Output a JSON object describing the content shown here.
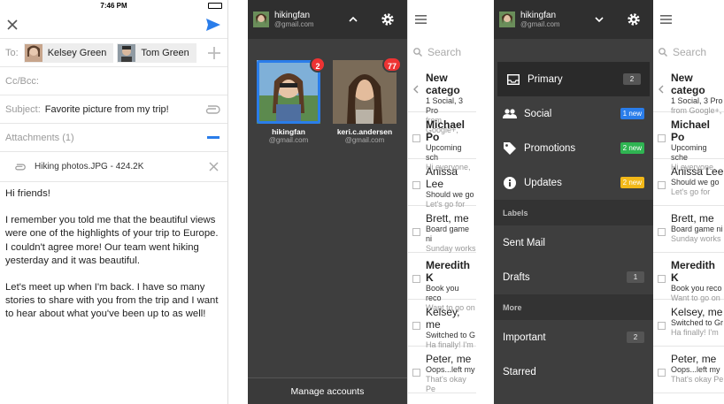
{
  "compose": {
    "time": "7:46 PM",
    "to_label": "To:",
    "recipients": [
      "Kelsey Green",
      "Tom Green"
    ],
    "ccbcc_label": "Cc/Bcc:",
    "subject_label": "Subject:",
    "subject_value": "Favorite picture from my trip!",
    "attachments_label": "Attachments (1)",
    "attachment_name": "Hiking photos.JPG - 424.2K",
    "body": [
      "Hi friends!",
      "I remember you told me that the beautiful views were one of the highlights of your trip to Europe. I couldn't agree more! Our team went hiking yesterday and it was beautiful.",
      "Let's meet up when I'm back. I have so many stories to share with you from the trip and I want to hear about what you've been up to as well!"
    ]
  },
  "switcher": {
    "user": "hikingfan",
    "user_email": "@gmail.com",
    "accounts": [
      {
        "name": "hikingfan",
        "email": "@gmail.com",
        "badge": "2"
      },
      {
        "name": "keri.c.andersen",
        "email": "@gmail.com",
        "badge": "77"
      }
    ],
    "manage_label": "Manage accounts"
  },
  "inbox1": {
    "search_placeholder": "Search",
    "mails": [
      {
        "from": "New catego",
        "subject": "1 Social, 3 Pro",
        "snippet": "from Google+,"
      },
      {
        "from": "Michael Po",
        "subject": "Upcoming sch",
        "snippet": "Hi everyone,"
      },
      {
        "from": "Anissa Lee",
        "subject": "Should we go",
        "snippet": "Let's go for"
      },
      {
        "from": "Brett, me",
        "subject": "Board game ni",
        "snippet": "Sunday works"
      },
      {
        "from": "Meredith K",
        "subject": "Book you reco",
        "snippet": "Want to go on"
      },
      {
        "from": "Kelsey, me",
        "subject": "Switched to G",
        "snippet": "Ha finally! I'm"
      },
      {
        "from": "Peter, me",
        "subject": "Oops...left my",
        "snippet": "That's okay Pe"
      }
    ]
  },
  "menu": {
    "user": "hikingfan",
    "user_email": "@gmail.com",
    "primary": {
      "label": "Primary",
      "count": "2"
    },
    "social": {
      "label": "Social",
      "badge": "1 new"
    },
    "promotions": {
      "label": "Promotions",
      "badge": "2 new"
    },
    "updates": {
      "label": "Updates",
      "badge": "2 new"
    },
    "labels_header": "Labels",
    "sent": "Sent Mail",
    "drafts": {
      "label": "Drafts",
      "count": "1"
    },
    "more_header": "More",
    "important": {
      "label": "Important",
      "count": "2"
    },
    "starred": "Starred"
  },
  "inbox2": {
    "search_placeholder": "Search",
    "mails": [
      {
        "from": "New catego",
        "subject": "1 Social, 3 Pro",
        "snippet": "from Google+,"
      },
      {
        "from": "Michael Po",
        "subject": "Upcoming sche",
        "snippet": "Hi everyone,"
      },
      {
        "from": "Anissa Lee",
        "subject": "Should we go",
        "snippet": "Let's go for"
      },
      {
        "from": "Brett, me",
        "subject": "Board game ni",
        "snippet": "Sunday works"
      },
      {
        "from": "Meredith K",
        "subject": "Book you reco",
        "snippet": "Want to go on"
      },
      {
        "from": "Kelsey, me",
        "subject": "Switched to Gr",
        "snippet": "Ha finally! I'm"
      },
      {
        "from": "Peter, me",
        "subject": "Oops...left my",
        "snippet": "That's okay Pe"
      }
    ]
  },
  "colors": {
    "accent": "#2a7dea",
    "drawer": "#3e3e3e",
    "badge_red": "#e33333",
    "social": "#2a7dea",
    "promotions": "#2fb452",
    "updates": "#f2b818"
  },
  "icons": [
    "close-icon",
    "send-icon",
    "add-icon",
    "paperclip-icon",
    "minus-icon",
    "gear-icon",
    "chevron-up-icon",
    "chevron-down-icon",
    "menu-icon",
    "search-icon",
    "inbox-icon",
    "people-icon",
    "tag-icon",
    "info-icon"
  ]
}
